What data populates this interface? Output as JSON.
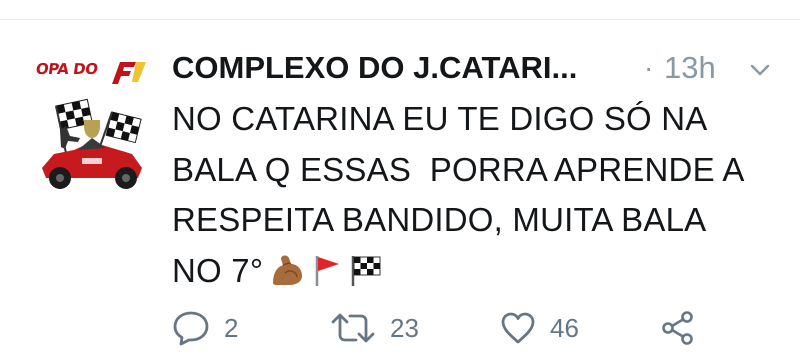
{
  "avatar": {
    "logo_text": "OPA DO"
  },
  "tweet": {
    "author_name": "COMPLEXO DO J.CATARI...",
    "separator": "·",
    "timestamp": "13h",
    "lines": [
      "NO CATARINA EU TE DIGO SÓ NA",
      "BALA Q ESSAS  PORRA APRENDE A",
      "RESPEITA BANDIDO, MUITA BALA",
      "NO 7°"
    ],
    "emojis": [
      "flexed-biceps-icon",
      "triangular-flag-icon",
      "chequered-flag-icon"
    ]
  },
  "actions": {
    "reply_count": "2",
    "retweet_count": "23",
    "like_count": "46"
  },
  "colors": {
    "text": "#14171a",
    "muted": "#8899a6",
    "action_icon": "#657786",
    "divider": "#e6ecf0",
    "logo_red": "#c0141a"
  }
}
